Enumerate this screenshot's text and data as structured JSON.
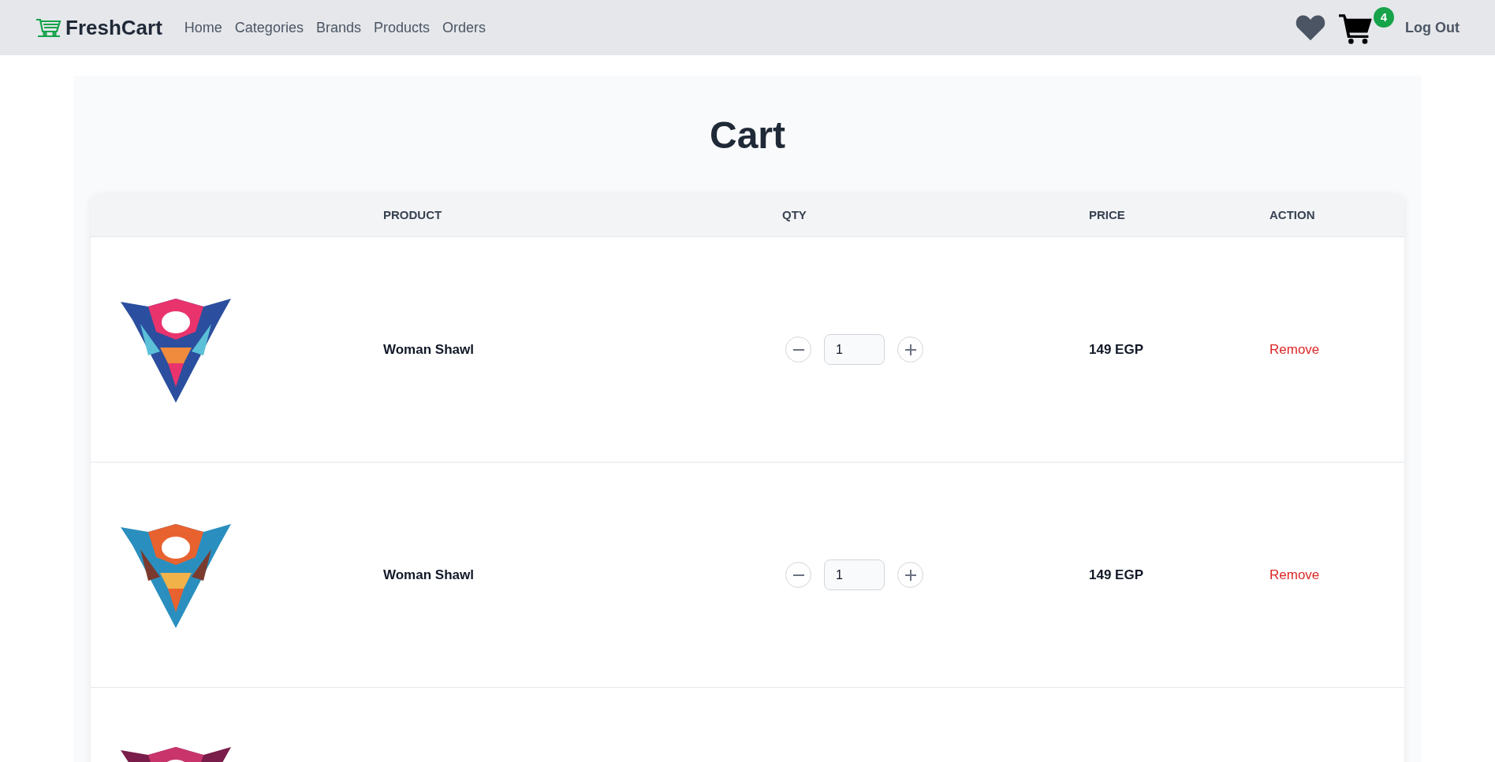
{
  "navbar": {
    "brand": "FreshCart",
    "links": [
      "Home",
      "Categories",
      "Brands",
      "Products",
      "Orders"
    ],
    "cart_count": "4",
    "logout": "Log Out"
  },
  "page_title": "Cart",
  "table": {
    "columns": [
      "PRODUCT",
      "QTY",
      "PRICE",
      "ACTION"
    ],
    "rows": [
      {
        "kind": "item",
        "name": "Woman Shawl",
        "qty": "1",
        "price": "149 EGP",
        "action": "Remove"
      },
      {
        "kind": "item",
        "name": "Woman Shawl",
        "qty": "1",
        "price": "149 EGP",
        "action": "Remove"
      },
      {
        "kind": "partial"
      }
    ]
  }
}
